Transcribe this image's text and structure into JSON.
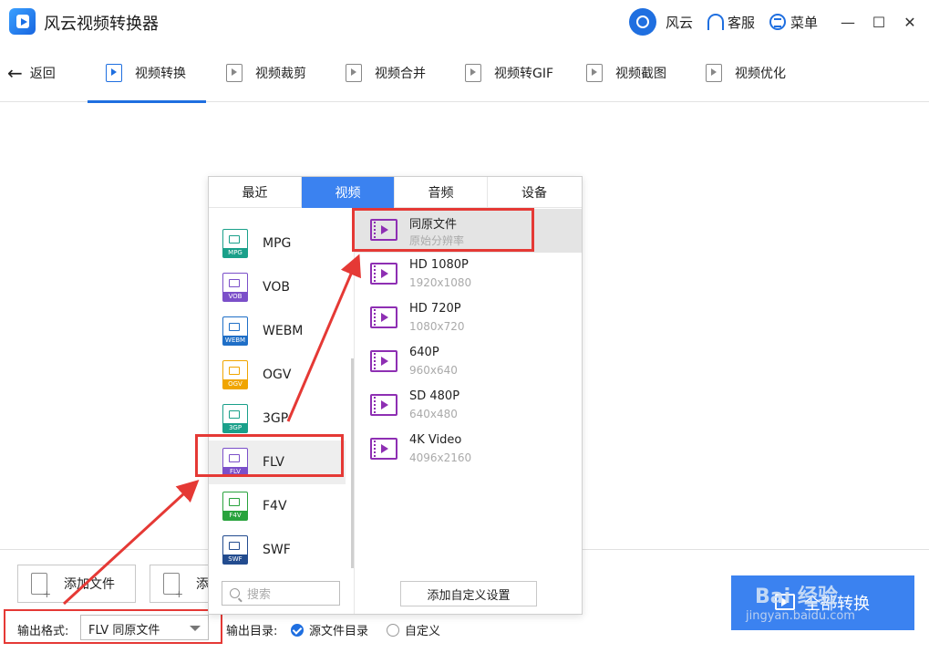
{
  "app": {
    "title": "风云视频转换器"
  },
  "titlebar": {
    "user": "风云",
    "service": "客服",
    "menu": "菜单",
    "minimize": "—",
    "maximize": "☐",
    "close": "✕"
  },
  "nav": {
    "back": "返回",
    "tabs": [
      {
        "label": "视频转换",
        "active": true
      },
      {
        "label": "视频裁剪"
      },
      {
        "label": "视频合并"
      },
      {
        "label": "视频转GIF"
      },
      {
        "label": "视频截图"
      },
      {
        "label": "视频优化"
      }
    ]
  },
  "popup": {
    "tabs": [
      "最近",
      "视频",
      "音频",
      "设备"
    ],
    "active_tab": "视频",
    "formats": [
      {
        "label": "MPG",
        "color": "#1aa08a"
      },
      {
        "label": "VOB",
        "color": "#7b4fc9"
      },
      {
        "label": "WEBM",
        "color": "#1f6fc7"
      },
      {
        "label": "OGV",
        "color": "#f0a500"
      },
      {
        "label": "3GP",
        "color": "#1aa08a"
      },
      {
        "label": "FLV",
        "color": "#7b4fc9",
        "selected": true
      },
      {
        "label": "F4V",
        "color": "#29a33d"
      },
      {
        "label": "SWF",
        "color": "#234c8f"
      }
    ],
    "resolutions": [
      {
        "name": "同原文件",
        "sub": "原始分辨率",
        "selected": true
      },
      {
        "name": "HD 1080P",
        "sub": "1920x1080"
      },
      {
        "name": "HD 720P",
        "sub": "1080x720"
      },
      {
        "name": "640P",
        "sub": "960x640"
      },
      {
        "name": "SD 480P",
        "sub": "640x480"
      },
      {
        "name": "4K Video",
        "sub": "4096x2160"
      }
    ],
    "search_placeholder": "搜索",
    "custom_button": "添加自定义设置"
  },
  "bottom": {
    "add_file": "添加文件",
    "add_folder": "添",
    "output_format_label": "输出格式:",
    "output_format_value": "FLV 同原文件",
    "output_dir_label": "输出目录:",
    "dir_options": [
      {
        "label": "源文件目录",
        "checked": true
      },
      {
        "label": "自定义"
      }
    ],
    "convert_all": "全部转换"
  },
  "watermark": {
    "text": "Bai 经验",
    "url": "jingyan.baidu.com"
  },
  "colors": {
    "accent": "#3b82f0",
    "highlight": "#e53935",
    "video_icon": "#8e2fb3"
  }
}
